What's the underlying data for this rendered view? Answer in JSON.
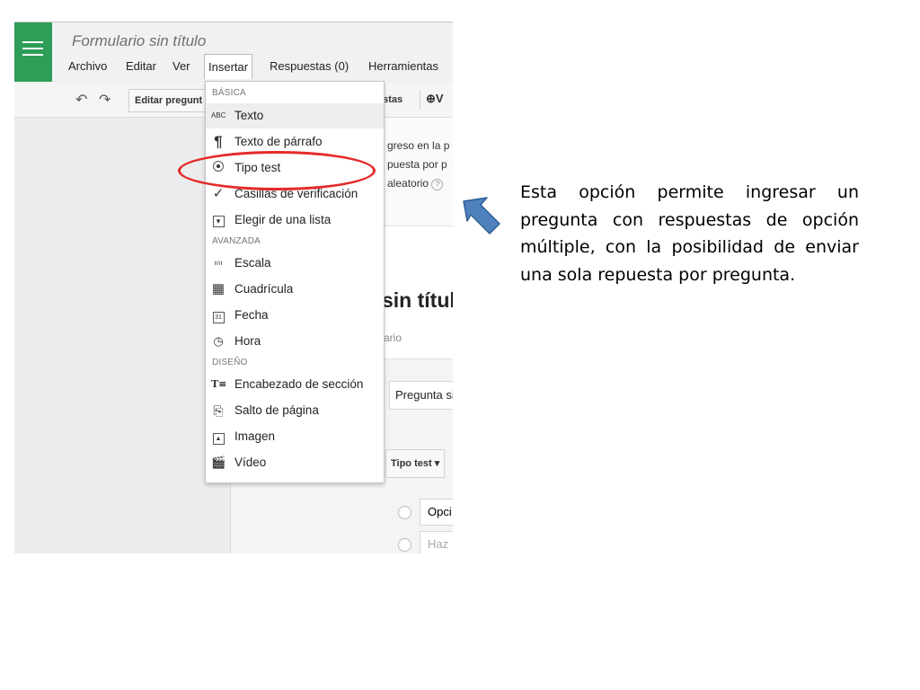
{
  "app": {
    "form_title": "Formulario sin título",
    "menus": [
      "Archivo",
      "Editar",
      "Ver",
      "Insertar",
      "Respuestas (0)",
      "Herramientas"
    ]
  },
  "toolbar": {
    "edit_question_label": "Editar pregunt",
    "answers_label": "estas",
    "send_label": "V"
  },
  "background": {
    "settings_lines": [
      "greso en la p",
      "puesta por p",
      "aleatorio"
    ],
    "help_glyph": "?",
    "doc_title": "sin títul",
    "doc_description": "ario",
    "question_title_field": "Pregunta si",
    "question_type_label": "Tipo test",
    "option_1": "Opci",
    "option_2_placeholder": "Haz"
  },
  "insert_menu": {
    "sections": [
      {
        "header": "BÁSICA",
        "items": [
          {
            "label": "Texto",
            "icon": "abc-icon",
            "glyph": "ABC"
          },
          {
            "label": "Texto de párrafo",
            "icon": "paragraph-icon",
            "glyph": "¶"
          },
          {
            "label": "Tipo test",
            "icon": "radio-icon",
            "glyph": ""
          },
          {
            "label": "Casillas de verificación",
            "icon": "checkmark-icon",
            "glyph": "✓"
          },
          {
            "label": "Elegir de una lista",
            "icon": "dropdown-icon",
            "glyph": "▾"
          }
        ]
      },
      {
        "header": "AVANZADA",
        "items": [
          {
            "label": "Escala",
            "icon": "scale-icon",
            "glyph": "ıııı"
          },
          {
            "label": "Cuadrícula",
            "icon": "grid-icon",
            "glyph": "▦"
          },
          {
            "label": "Fecha",
            "icon": "calendar-icon",
            "glyph": "31"
          },
          {
            "label": "Hora",
            "icon": "clock-icon",
            "glyph": "◷"
          }
        ]
      },
      {
        "header": "DISEÑO",
        "items": [
          {
            "label": "Encabezado de sección",
            "icon": "section-header-icon",
            "glyph": "T≡"
          },
          {
            "label": "Salto de página",
            "icon": "page-break-icon",
            "glyph": "⎘"
          },
          {
            "label": "Imagen",
            "icon": "image-icon",
            "glyph": "▲"
          },
          {
            "label": "Vídeo",
            "icon": "video-icon",
            "glyph": "🎬"
          }
        ]
      }
    ]
  },
  "annotation": {
    "text": "Esta opción permite ingresar un pregunta con respuestas de opción múltiple, con la posibilidad de enviar una sola repuesta por pregunta.",
    "highlight_color": "#e52a2a",
    "arrow_color": "#4f81bd"
  },
  "colors": {
    "brand_green": "#2e9d57"
  }
}
